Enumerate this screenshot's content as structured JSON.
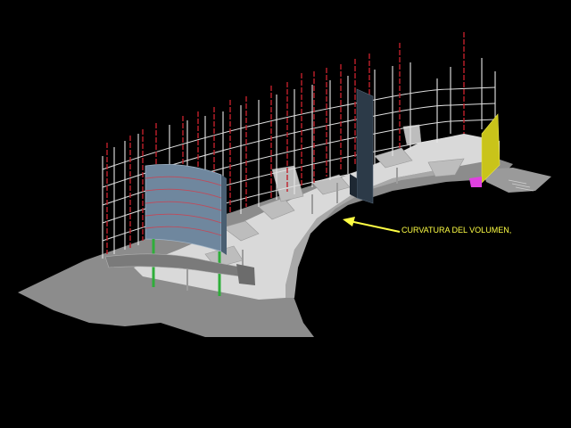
{
  "annotation": {
    "label": "CURVATURA DEL VOLUMEN,",
    "color": "#ffff44"
  },
  "colors": {
    "background": "#000000",
    "platform_dark": "#8c8c8c",
    "platform_light": "#d9d9d9",
    "platform_mid": "#b8b8b8",
    "frame_white": "#e8e8e8",
    "frame_red": "#c0202a",
    "glass_panel": "#6f879e",
    "dark_glass": "#2c3a48",
    "yellow_panel": "#c9c41a",
    "magenta_accent": "#e040e0",
    "green_column": "#2fae3a"
  }
}
